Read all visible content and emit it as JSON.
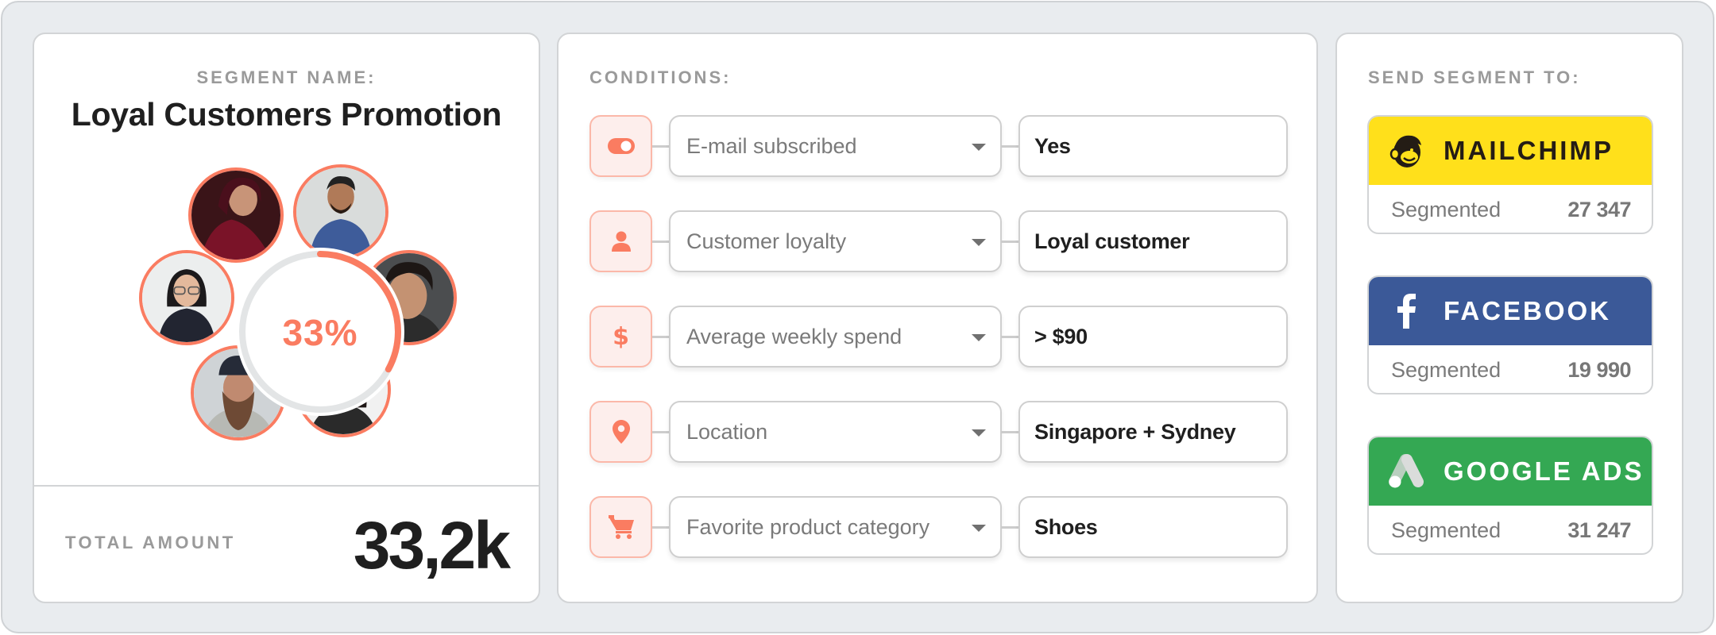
{
  "segment": {
    "label": "SEGMENT NAME:",
    "title": "Loyal Customers Promotion",
    "audience_share_percent": 33,
    "audience_share_label": "33%",
    "avatars": [
      {
        "name": "avatar-woman-headscarf"
      },
      {
        "name": "avatar-man-beard-smiling"
      },
      {
        "name": "avatar-young-man"
      },
      {
        "name": "avatar-woman-dark-hair"
      },
      {
        "name": "avatar-man-cap-beard"
      },
      {
        "name": "avatar-woman-glasses"
      }
    ],
    "total_label": "TOTAL AMOUNT",
    "total_value": "33,2k"
  },
  "conditions": {
    "label": "CONDITIONS:",
    "rows": [
      {
        "icon": "toggle-icon",
        "field": "E-mail subscribed",
        "value": "Yes"
      },
      {
        "icon": "user-icon",
        "field": "Customer loyalty",
        "value": "Loyal customer"
      },
      {
        "icon": "dollar-icon",
        "field": "Average weekly spend",
        "value": "> $90"
      },
      {
        "icon": "location-pin-icon",
        "field": "Location",
        "value": "Singapore + Sydney"
      },
      {
        "icon": "shopping-cart-icon",
        "field": "Favorite product category",
        "value": "Shoes"
      }
    ]
  },
  "destinations": {
    "label": "SEND SEGMENT TO:",
    "items": [
      {
        "name": "MAILCHIMP",
        "icon": "mailchimp-logo-icon",
        "color": "#ffe01b",
        "text_color": "#241c15",
        "segmented_label": "Segmented",
        "count": "27 347"
      },
      {
        "name": "FACEBOOK",
        "icon": "facebook-logo-icon",
        "color": "#3b5998",
        "text_color": "#ffffff",
        "segmented_label": "Segmented",
        "count": "19 990"
      },
      {
        "name": "GOOGLE ADS",
        "icon": "google-ads-logo-icon",
        "color": "#34a853",
        "text_color": "#ffffff",
        "segmented_label": "Segmented",
        "count": "31 247"
      }
    ]
  },
  "colors": {
    "accent": "#fa7c61",
    "accent_light": "#fdeeec",
    "ring_track": "#e3e5e6",
    "background": "#e9ecef"
  }
}
